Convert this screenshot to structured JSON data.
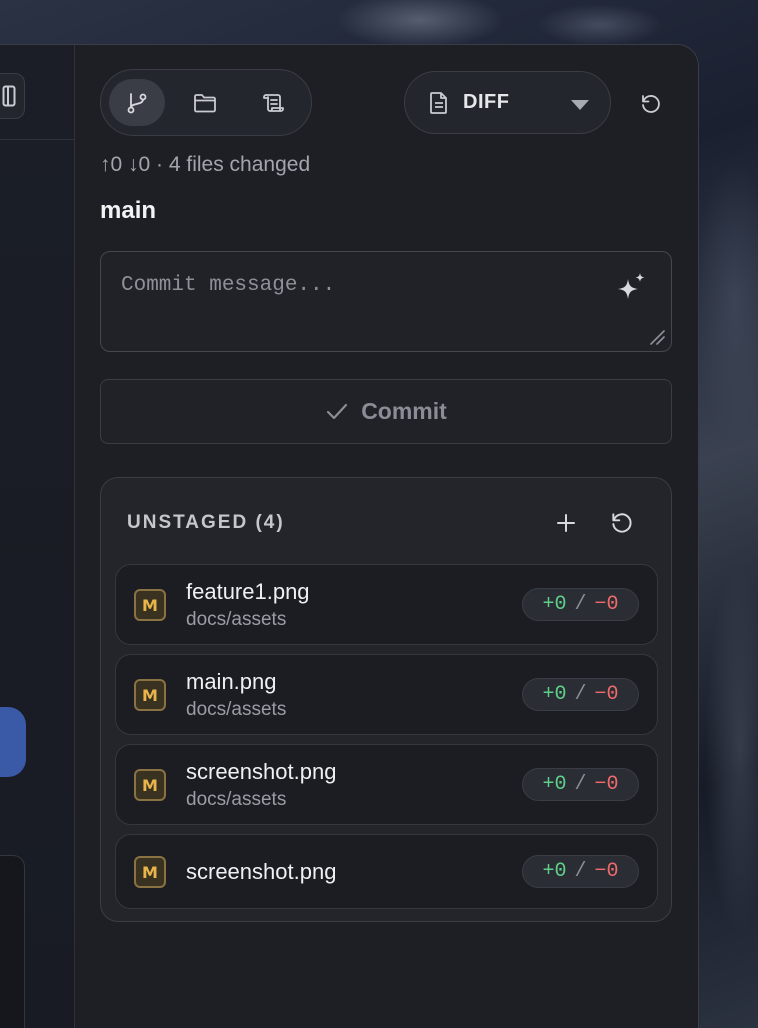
{
  "toolbar": {
    "modes": [
      {
        "name": "source-control",
        "icon": "git-branch-icon",
        "active": true
      },
      {
        "name": "files",
        "icon": "folder-icon",
        "active": false
      },
      {
        "name": "history",
        "icon": "scroll-icon",
        "active": false
      }
    ],
    "view_select": {
      "icon": "document-icon",
      "label": "DIFF"
    },
    "refresh_icon": "refresh-icon"
  },
  "repo": {
    "sync_status": "↑0 ↓0 · 4 files changed",
    "branch": "main"
  },
  "commit": {
    "message_value": "",
    "placeholder": "Commit message...",
    "generate_icon": "sparkle-icon",
    "button_label": "Commit"
  },
  "unstaged": {
    "title": "UNSTAGED (4)",
    "files": [
      {
        "status": "M",
        "name": "feature1.png",
        "path": "docs/assets",
        "added": "+0",
        "sep": "/",
        "removed": "−0"
      },
      {
        "status": "M",
        "name": "main.png",
        "path": "docs/assets",
        "added": "+0",
        "sep": "/",
        "removed": "−0"
      },
      {
        "status": "M",
        "name": "screenshot.png",
        "path": "docs/assets",
        "added": "+0",
        "sep": "/",
        "removed": "−0"
      },
      {
        "status": "M",
        "name": "screenshot.png",
        "path": "",
        "added": "+0",
        "sep": "/",
        "removed": "−0"
      }
    ]
  },
  "colors": {
    "added": "#5fd08a",
    "removed": "#ef6b6b",
    "modified_badge": "#e8b54c",
    "accent_blue": "#3a5aa8"
  }
}
